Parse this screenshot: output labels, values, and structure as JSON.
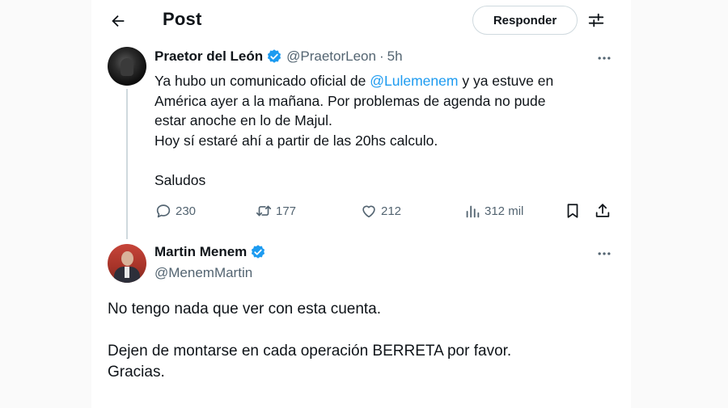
{
  "header": {
    "title": "Post",
    "reply_label": "Responder",
    "back_icon": "arrow-left-icon",
    "filter_icon": "sliders-icon"
  },
  "tweet1": {
    "name": "Praetor del León",
    "handle": "@PraetorLeon",
    "separator": "·",
    "time": "5h",
    "text": {
      "line1_before": "Ya hubo un comunicado oficial de ",
      "mention": "@Lulemenem",
      "line1_after": " y ya estuve en",
      "line2": "América ayer a la mañana. Por problemas de agenda no pude",
      "line3": "estar anoche en lo de Majul.",
      "line4": "Hoy sí estaré ahí a partir de las 20hs calculo.",
      "line5": "Saludos"
    },
    "stats": {
      "replies": "230",
      "reposts": "177",
      "likes": "212",
      "views": "312 mil"
    }
  },
  "tweet2": {
    "name": "Martin Menem",
    "handle": "@MenemMartin",
    "text": {
      "line1": "No tengo nada que ver con esta cuenta.",
      "line2": "Dejen de montarse en cada operación BERRETA por favor.",
      "line3": "Gracias."
    }
  },
  "colors": {
    "accent": "#1d9bf0",
    "text": "#0f1419",
    "secondary": "#536471",
    "border": "#cfd9de"
  }
}
